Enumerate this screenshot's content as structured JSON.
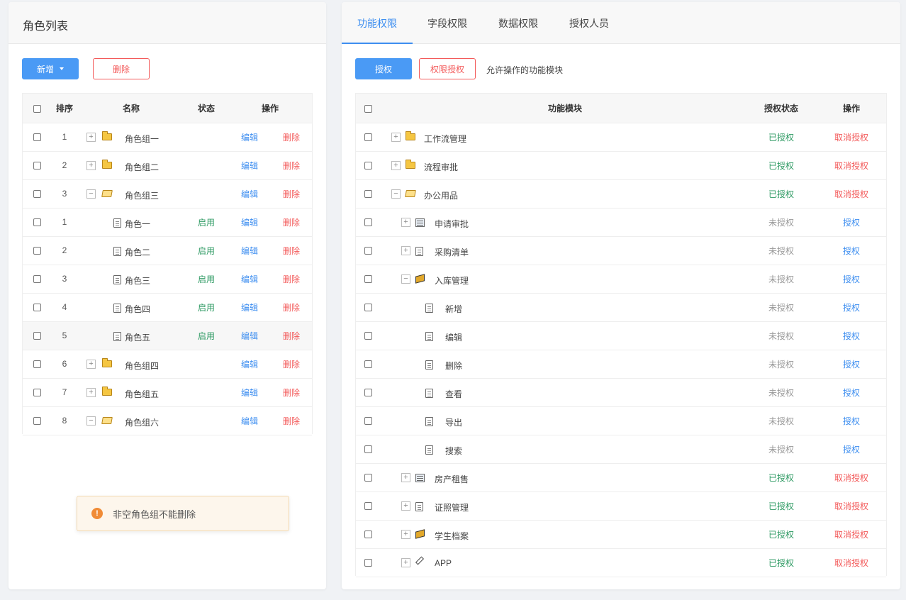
{
  "left": {
    "title": "角色列表",
    "add_label": "新增",
    "delete_label": "删除",
    "columns": [
      "排序",
      "名称",
      "状态",
      "操作"
    ],
    "rows": [
      {
        "order": "1",
        "level": 0,
        "toggle": "+",
        "icon": "folder",
        "name": "角色组一",
        "status": "",
        "edit": "编辑",
        "del": "删除"
      },
      {
        "order": "2",
        "level": 0,
        "toggle": "+",
        "icon": "folder",
        "name": "角色组二",
        "status": "",
        "edit": "编辑",
        "del": "删除"
      },
      {
        "order": "3",
        "level": 0,
        "toggle": "−",
        "icon": "folder-open",
        "name": "角色组三",
        "status": "",
        "edit": "编辑",
        "del": "删除"
      },
      {
        "order": "1",
        "level": 1,
        "toggle": "",
        "icon": "doc",
        "name": "角色一",
        "status": "启用",
        "edit": "编辑",
        "del": "删除"
      },
      {
        "order": "2",
        "level": 1,
        "toggle": "",
        "icon": "doc",
        "name": "角色二",
        "status": "启用",
        "edit": "编辑",
        "del": "删除"
      },
      {
        "order": "3",
        "level": 1,
        "toggle": "",
        "icon": "doc",
        "name": "角色三",
        "status": "启用",
        "edit": "编辑",
        "del": "删除"
      },
      {
        "order": "4",
        "level": 1,
        "toggle": "",
        "icon": "doc",
        "name": "角色四",
        "status": "启用",
        "edit": "编辑",
        "del": "删除"
      },
      {
        "order": "5",
        "level": 1,
        "toggle": "",
        "icon": "doc",
        "name": "角色五",
        "status": "启用",
        "edit": "编辑",
        "del": "删除",
        "hover": true
      },
      {
        "order": "6",
        "level": 0,
        "toggle": "+",
        "icon": "folder",
        "name": "角色组四",
        "status": "",
        "edit": "编辑",
        "del": "删除"
      },
      {
        "order": "7",
        "level": 0,
        "toggle": "+",
        "icon": "folder",
        "name": "角色组五",
        "status": "",
        "edit": "编辑",
        "del": "删除"
      },
      {
        "order": "8",
        "level": 0,
        "toggle": "−",
        "icon": "folder-open",
        "name": "角色组六",
        "status": "",
        "edit": "编辑",
        "del": "删除"
      }
    ],
    "toast": "非空角色组不能删除",
    "toast_icon": "!"
  },
  "right": {
    "tabs": [
      "功能权限",
      "字段权限",
      "数据权限",
      "授权人员"
    ],
    "active_tab": 0,
    "authorize_label": "授权",
    "perm_authorize_label": "权限授权",
    "hint": "允许操作的功能模块",
    "columns": [
      "功能模块",
      "授权状态",
      "操作"
    ],
    "rows": [
      {
        "level": 0,
        "toggle": "+",
        "icon": "folder",
        "name": "工作流管理",
        "status": "已授权",
        "authorized": true,
        "action": "取消授权"
      },
      {
        "level": 0,
        "toggle": "+",
        "icon": "folder",
        "name": "流程审批",
        "status": "已授权",
        "authorized": true,
        "action": "取消授权"
      },
      {
        "level": 0,
        "toggle": "−",
        "icon": "folder-open",
        "name": "办公用品",
        "status": "已授权",
        "authorized": true,
        "action": "取消授权"
      },
      {
        "level": 1,
        "toggle": "+",
        "icon": "table",
        "name": "申请审批",
        "status": "未授权",
        "authorized": false,
        "action": "授权"
      },
      {
        "level": 1,
        "toggle": "+",
        "icon": "doc",
        "name": "采购清单",
        "status": "未授权",
        "authorized": false,
        "action": "授权"
      },
      {
        "level": 1,
        "toggle": "−",
        "icon": "box",
        "name": "入库管理",
        "status": "未授权",
        "authorized": false,
        "action": "授权"
      },
      {
        "level": 2,
        "toggle": "",
        "icon": "doc",
        "name": "新增",
        "status": "未授权",
        "authorized": false,
        "action": "授权"
      },
      {
        "level": 2,
        "toggle": "",
        "icon": "doc",
        "name": "编辑",
        "status": "未授权",
        "authorized": false,
        "action": "授权"
      },
      {
        "level": 2,
        "toggle": "",
        "icon": "doc",
        "name": "删除",
        "status": "未授权",
        "authorized": false,
        "action": "授权"
      },
      {
        "level": 2,
        "toggle": "",
        "icon": "doc",
        "name": "查看",
        "status": "未授权",
        "authorized": false,
        "action": "授权"
      },
      {
        "level": 2,
        "toggle": "",
        "icon": "doc",
        "name": "导出",
        "status": "未授权",
        "authorized": false,
        "action": "授权"
      },
      {
        "level": 2,
        "toggle": "",
        "icon": "doc",
        "name": "搜索",
        "status": "未授权",
        "authorized": false,
        "action": "授权"
      },
      {
        "level": 1,
        "toggle": "+",
        "icon": "table",
        "name": "房产租售",
        "status": "已授权",
        "authorized": true,
        "action": "取消授权"
      },
      {
        "level": 1,
        "toggle": "+",
        "icon": "doc",
        "name": "证照管理",
        "status": "已授权",
        "authorized": true,
        "action": "取消授权"
      },
      {
        "level": 1,
        "toggle": "+",
        "icon": "box",
        "name": "学生档案",
        "status": "已授权",
        "authorized": true,
        "action": "取消授权"
      },
      {
        "level": 1,
        "toggle": "+",
        "icon": "pen",
        "name": "APP",
        "status": "已授权",
        "authorized": true,
        "action": "取消授权"
      }
    ]
  },
  "colors": {
    "primary": "#4a9af5",
    "danger": "#f35a5a",
    "success": "#2e9a63",
    "muted": "#999999",
    "warning": "#f08b36"
  }
}
